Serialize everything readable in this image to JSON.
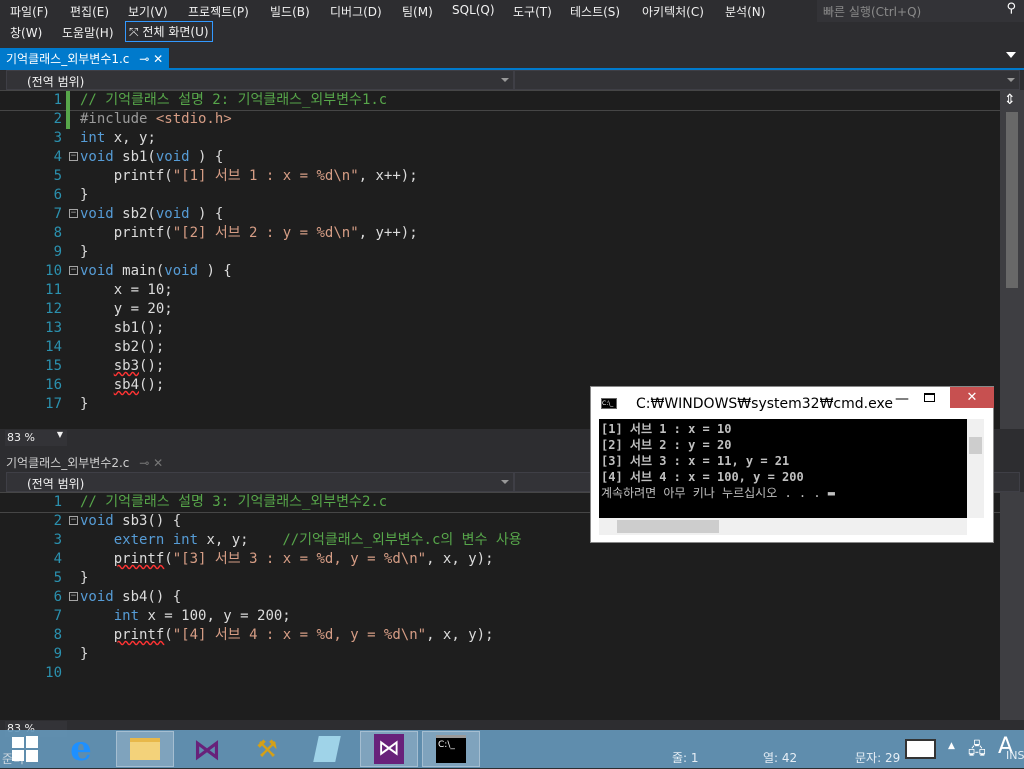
{
  "menu": {
    "row1": [
      "파일(F)",
      "편집(E)",
      "보기(V)",
      "프로젝트(P)",
      "빌드(B)",
      "디버그(D)",
      "팀(M)",
      "SQL(Q)",
      "도구(T)",
      "테스트(S)",
      "아키텍처(C)",
      "분석(N)"
    ],
    "row2": [
      "창(W)",
      "도움말(H)"
    ],
    "fullscreen": "전체 화면(U)",
    "quick_launch": "빠른 실행(Ctrl+Q)"
  },
  "pane1": {
    "tab": "기억클래스_외부변수1.c",
    "scope": "(전역 범위)",
    "zoom": "83 %",
    "lines": [
      [
        [
          "c",
          "// 기억클래스 설명 2: 기억클래스_외부변수1.c"
        ]
      ],
      [
        [
          "p",
          "#include "
        ],
        [
          "s",
          "<stdio.h>"
        ]
      ],
      [
        [
          "k",
          "int"
        ],
        [
          "t",
          " x, y;"
        ]
      ],
      [
        [
          "k",
          "void"
        ],
        [
          "t",
          " sb1("
        ],
        [
          "k",
          "void"
        ],
        [
          "t",
          " ) {"
        ]
      ],
      [
        [
          "t",
          "    printf("
        ],
        [
          "s",
          "\"[1] 서브 1 : x = %d\\n\""
        ],
        [
          "t",
          ", x++);"
        ]
      ],
      [
        [
          "t",
          "}"
        ]
      ],
      [
        [
          "k",
          "void"
        ],
        [
          "t",
          " sb2("
        ],
        [
          "k",
          "void"
        ],
        [
          "t",
          " ) {"
        ]
      ],
      [
        [
          "t",
          "    printf("
        ],
        [
          "s",
          "\"[2] 서브 2 : y = %d\\n\""
        ],
        [
          "t",
          ", y++);"
        ]
      ],
      [
        [
          "t",
          "}"
        ]
      ],
      [
        [
          "k",
          "void"
        ],
        [
          "t",
          " main("
        ],
        [
          "k",
          "void"
        ],
        [
          "t",
          " ) {"
        ]
      ],
      [
        [
          "t",
          "    x = 10;"
        ]
      ],
      [
        [
          "t",
          "    y = 20;"
        ]
      ],
      [
        [
          "t",
          "    sb1();"
        ]
      ],
      [
        [
          "t",
          "    sb2();"
        ]
      ],
      [
        [
          "t",
          "    "
        ],
        [
          "sq",
          "sb3"
        ],
        [
          "t",
          "();"
        ]
      ],
      [
        [
          "t",
          "    "
        ],
        [
          "sq",
          "sb4"
        ],
        [
          "t",
          "();"
        ]
      ],
      [
        [
          "t",
          "}"
        ]
      ]
    ],
    "folds": [
      4,
      7,
      10
    ]
  },
  "pane2": {
    "tab": "기억클래스_외부변수2.c",
    "scope": "(전역 범위)",
    "zoom": "83 %",
    "lines": [
      [
        [
          "c",
          "// 기억클래스 설명 3: 기억클래스_외부변수2.c"
        ]
      ],
      [
        [
          "k",
          "void"
        ],
        [
          "t",
          " sb3() {"
        ]
      ],
      [
        [
          "t",
          "    "
        ],
        [
          "k",
          "extern int"
        ],
        [
          "t",
          " x, y;    "
        ],
        [
          "c",
          "//기억클래스_외부변수.c의 변수 사용"
        ]
      ],
      [
        [
          "t",
          "    "
        ],
        [
          "sq",
          "printf"
        ],
        [
          "t",
          "("
        ],
        [
          "s",
          "\"[3] 서브 3 : x = %d, y = %d\\n\""
        ],
        [
          "t",
          ", x, y);"
        ]
      ],
      [
        [
          "t",
          "}"
        ]
      ],
      [
        [
          "k",
          "void"
        ],
        [
          "t",
          " sb4() {"
        ]
      ],
      [
        [
          "t",
          "    "
        ],
        [
          "k",
          "int"
        ],
        [
          "t",
          " x = 100, y = 200;"
        ]
      ],
      [
        [
          "t",
          "    "
        ],
        [
          "sq",
          "printf"
        ],
        [
          "t",
          "("
        ],
        [
          "s",
          "\"[4] 서브 4 : x = %d, y = %d\\n\""
        ],
        [
          "t",
          ", x, y);"
        ]
      ],
      [
        [
          "t",
          "}"
        ]
      ],
      []
    ],
    "folds": [
      2,
      6
    ]
  },
  "cmd": {
    "title": "C:₩WINDOWS₩system32₩cmd.exe",
    "output": [
      "[1] 서브 1 : x = 10",
      "[2] 서브 2 : y = 20",
      "[3] 서브 3 : x = 11, y = 21",
      "[4] 서브 4 : x = 100, y = 200",
      "계속하려면 아무 키나 누르십시오 . . . ▬"
    ]
  },
  "status": {
    "ready": "준비",
    "line": "줄: 1",
    "col": "열: 42",
    "char": "문자: 29",
    "mode": "INS"
  },
  "taskbar": {
    "apps": [
      "start-icon",
      "internet-explorer-icon",
      "file-explorer-icon",
      "visual-studio-icon",
      "tools-icon",
      "notepad-icon",
      "visual-studio-active-icon",
      "cmd-icon"
    ]
  }
}
